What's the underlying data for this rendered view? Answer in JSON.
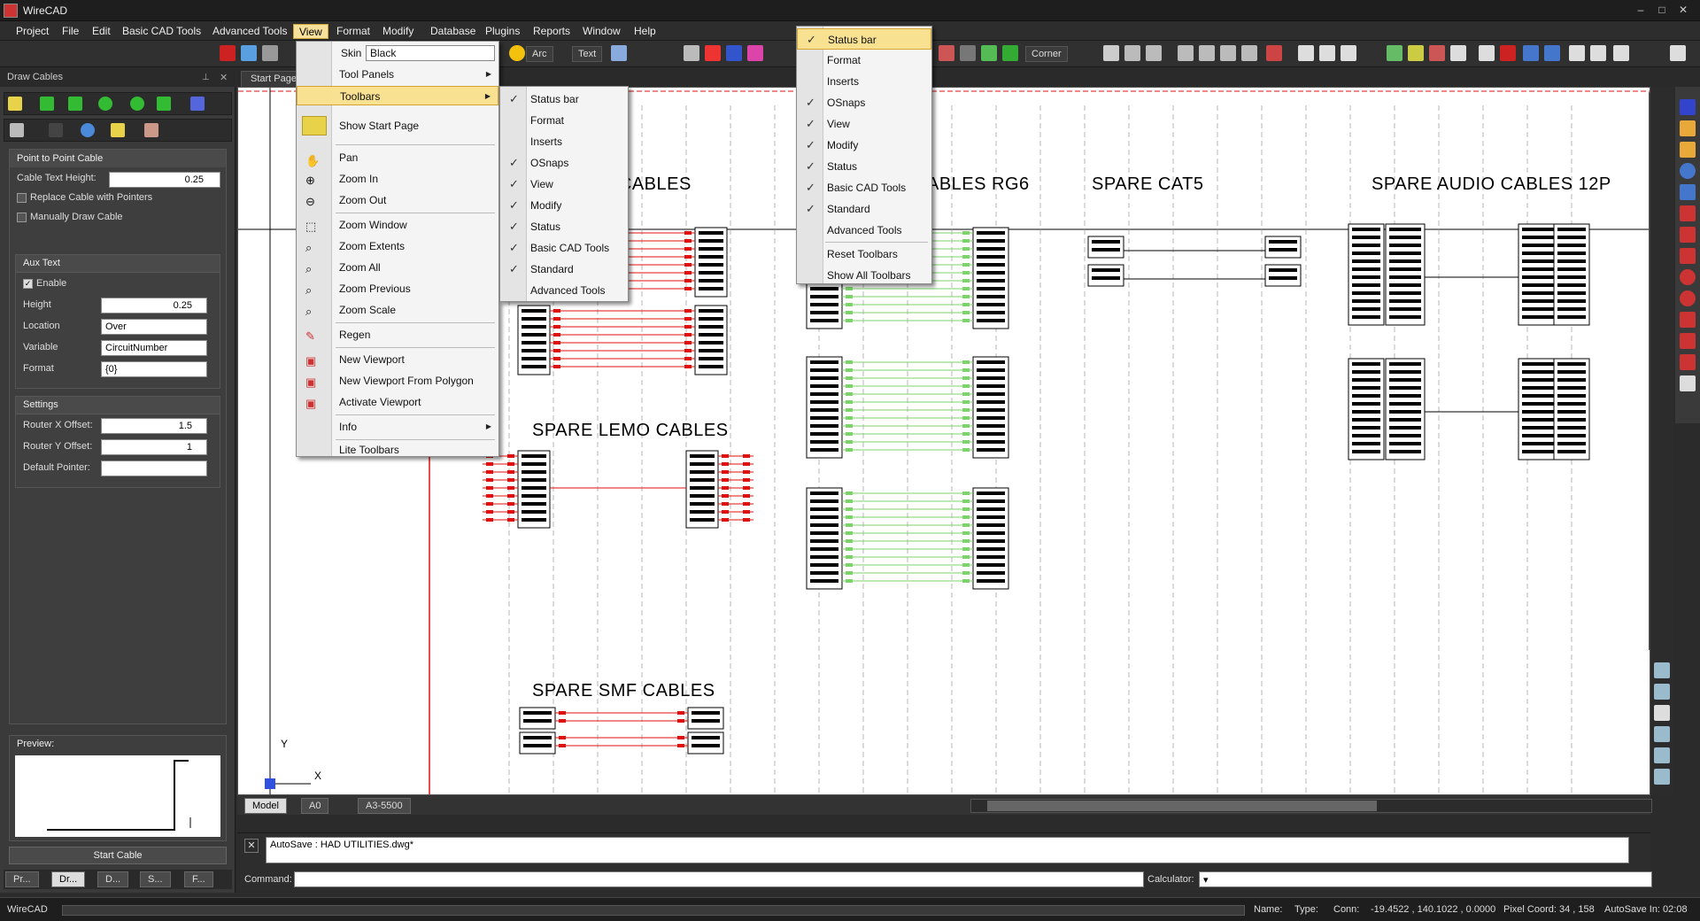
{
  "app": {
    "title": "WireCAD"
  },
  "window_buttons": [
    "–",
    "□",
    "✕"
  ],
  "menubar": {
    "items": [
      "Project",
      "File",
      "Edit",
      "Basic CAD Tools",
      "Advanced Tools",
      "View",
      "Format",
      "Modify",
      "Database",
      "Plugins",
      "Reports",
      "Window",
      "Help"
    ],
    "active": "View"
  },
  "toolbar": {
    "arc_label": "Arc",
    "text_label": "Text",
    "corner_label": "Corner"
  },
  "left_panel": {
    "title": "Draw Cables",
    "section_title": "Point to Point Cable",
    "cable_text_height_label": "Cable Text Height:",
    "cable_text_height_value": "0.25",
    "replace_cable_label": "Replace Cable with Pointers",
    "manual_draw_label": "Manually Draw Cable",
    "aux_text": {
      "title": "Aux Text",
      "enable_label": "Enable",
      "height_label": "Height",
      "height_value": "0.25",
      "location_label": "Location",
      "location_value": "Over",
      "variable_label": "Variable",
      "variable_value": "CircuitNumber",
      "format_label": "Format",
      "format_value": "{0}"
    },
    "settings": {
      "title": "Settings",
      "router_x_label": "Router X Offset:",
      "router_x_value": "1.5",
      "router_y_label": "Router Y Offset:",
      "router_y_value": "1",
      "default_pointer_label": "Default Pointer:",
      "default_pointer_value": ""
    },
    "preview_label": "Preview:",
    "start_cable_label": "Start Cable",
    "bottom_tabs": [
      "Pr...",
      "Dr...",
      "D...",
      "S...",
      "F..."
    ]
  },
  "doc_tab": {
    "label": "Start Page"
  },
  "drawing": {
    "titles": {
      "spare_cables": "E CABLES",
      "spare_rg6": "ABLES RG6",
      "spare_cat5": "SPARE CAT5",
      "spare_audio": "SPARE AUDIO CABLES 12P",
      "spare_lemo": "SPARE LEMO CABLES",
      "spare_smf": "SPARE SMF CABLES"
    },
    "axis_y": "Y",
    "axis_x": "X"
  },
  "layout_tabs": [
    "Model",
    "A0",
    "A3-5500"
  ],
  "command": {
    "autosave_text": "AutoSave : HAD UTILITIES.dwg*",
    "command_label": "Command:",
    "calculator_label": "Calculator:",
    "calculator_value": "▾"
  },
  "statusbar": {
    "app": "WireCAD",
    "name_label": "Name:",
    "type_label": "Type:",
    "conn_label": "Conn:",
    "coords": "-19.4522 , 140.1022 , 0.0000",
    "pixel_coord": "Pixel Coord: 34 , 158",
    "autosave_in": "AutoSave In: 02:08"
  },
  "view_menu": {
    "skin_label": "Skin",
    "skin_value": "Black",
    "items": [
      "Tool Panels",
      "Toolbars",
      "Show Start Page",
      "Pan",
      "Zoom In",
      "Zoom Out",
      "Zoom Window",
      "Zoom Extents",
      "Zoom All",
      "Zoom Previous",
      "Zoom Scale",
      "Regen",
      "New Viewport",
      "New Viewport From Polygon",
      "Activate Viewport",
      "Info",
      "Lite Toolbars"
    ]
  },
  "toolbars_submenu": {
    "items": [
      "Status bar",
      "Format",
      "Inserts",
      "OSnaps",
      "View",
      "Modify",
      "Status",
      "Basic CAD Tools",
      "Standard",
      "Advanced Tools"
    ],
    "checked": [
      "Status bar",
      "OSnaps",
      "View",
      "Modify",
      "Status",
      "Basic CAD Tools",
      "Standard"
    ]
  },
  "toolbars_popup": {
    "items": [
      "Status bar",
      "Format",
      "Inserts",
      "OSnaps",
      "View",
      "Modify",
      "Status",
      "Basic CAD Tools",
      "Standard",
      "Advanced Tools",
      "Reset Toolbars",
      "Show All Toolbars"
    ],
    "checked": [
      "Status bar",
      "OSnaps",
      "View",
      "Modify",
      "Status",
      "Basic CAD Tools",
      "Standard"
    ]
  },
  "colors": {
    "accent_menu": "#f7e09a",
    "cable_red": "#e01010",
    "cable_green": "#7cd36a"
  }
}
